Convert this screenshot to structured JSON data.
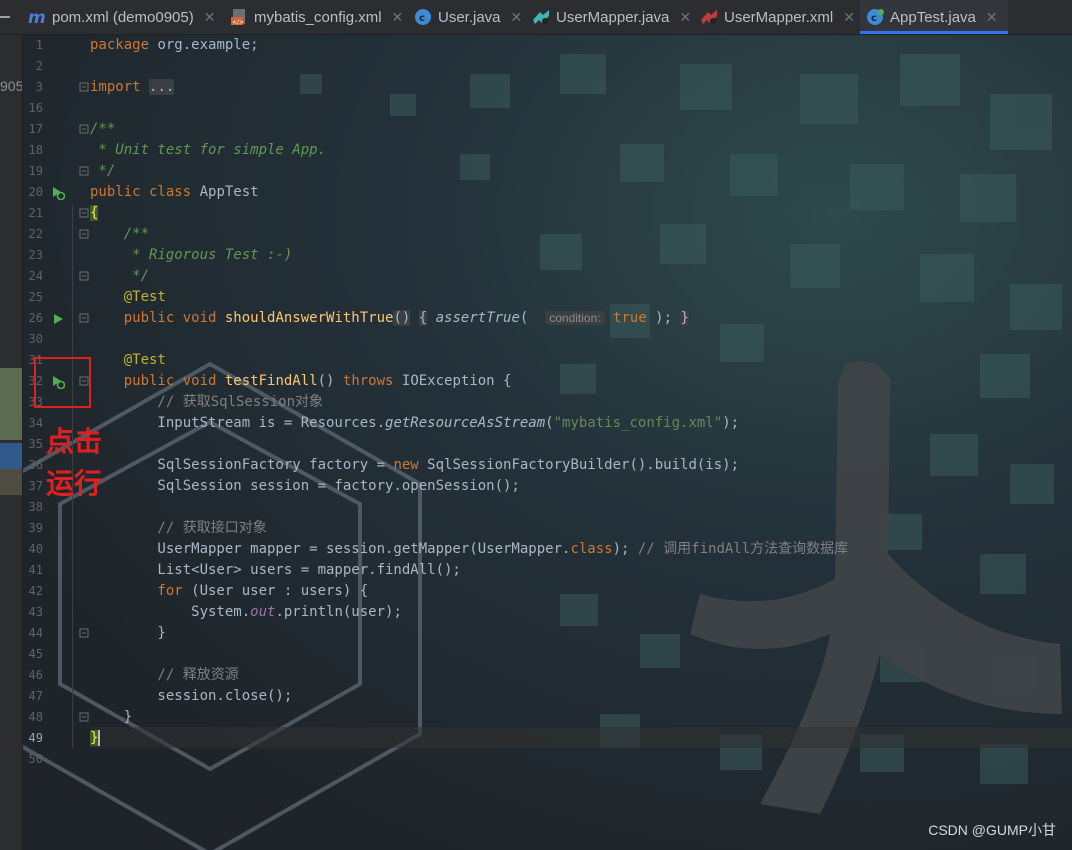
{
  "tabs": [
    {
      "label": "pom.xml (demo0905)",
      "icon": "maven-icon",
      "active": false
    },
    {
      "label": "mybatis_config.xml",
      "icon": "xml-file-icon",
      "active": false
    },
    {
      "label": "User.java",
      "icon": "java-class-icon",
      "active": false
    },
    {
      "label": "UserMapper.java",
      "icon": "mapper-interface-icon",
      "active": false
    },
    {
      "label": "UserMapper.xml",
      "icon": "mapper-xml-icon",
      "active": false
    },
    {
      "label": "AppTest.java",
      "icon": "java-test-class-icon",
      "active": true
    }
  ],
  "left_strip_fragment": "905",
  "line_numbers": [
    "1",
    "2",
    "3",
    "16",
    "17",
    "18",
    "19",
    "20",
    "21",
    "22",
    "23",
    "24",
    "25",
    "26",
    "30",
    "31",
    "32",
    "33",
    "34",
    "35",
    "36",
    "37",
    "38",
    "39",
    "40",
    "41",
    "42",
    "43",
    "44",
    "45",
    "46",
    "47",
    "48",
    "49",
    "50"
  ],
  "current_line": "49",
  "code": {
    "l1_kw": "package",
    "l1_rest": " org.example;",
    "l3_kw": "import",
    "l3_fold": "...",
    "l17": "/**",
    "l18": " * Unit test for simple App.",
    "l19": " */",
    "l20_kw": "public class",
    "l20_rest": " AppTest",
    "l21": "{",
    "l22": "    /**",
    "l23": "     * Rigorous Test :-)",
    "l24": "     */",
    "l25": "    @Test",
    "l26_kw": "    public void",
    "l26_fn": "shouldAnswerWithTrue",
    "l26_paren": "()",
    "l26_open": "{",
    "l26_call": "assertTrue",
    "l26_hint": "condition:",
    "l26_val": "true",
    "l26_end": " );",
    "l26_close": "}",
    "l31": "    @Test",
    "l32_kw": "    public void",
    "l32_fn": "testFindAll",
    "l32_mid": "()",
    "l32_throws": "throws",
    "l32_rest": " IOException {",
    "l33": "        // 获取SqlSession对象",
    "l34_a": "        InputStream is = Resources.",
    "l34_call": "getResourceAsStream",
    "l34_b": "(",
    "l34_str": "\"mybatis_config.xml\"",
    "l34_c": ");",
    "l36_a": "        SqlSessionFactory factory = ",
    "l36_new": "new",
    "l36_b": " SqlSessionFactoryBuilder().build(is);",
    "l37": "        SqlSession session = factory.openSession();",
    "l39": "        // 获取接口对象",
    "l40_a": "        UserMapper mapper = session.getMapper(UserMapper.",
    "l40_kw": "class",
    "l40_b": ");",
    "l40_cm": " // 调用findAll方法查询数据库",
    "l41": "        List<User> users = mapper.findAll();",
    "l42_kw": "        for",
    "l42_rest": " (User user : users) {",
    "l43_a": "            System.",
    "l43_fld": "out",
    "l43_b": ".println(user);",
    "l44": "        }",
    "l46": "        // 释放资源",
    "l47": "        session.close();",
    "l48": "    }",
    "l49": "}"
  },
  "annotation": {
    "line1": "点击",
    "line2": "运行"
  },
  "watermark": "CSDN @GUMP小甘"
}
